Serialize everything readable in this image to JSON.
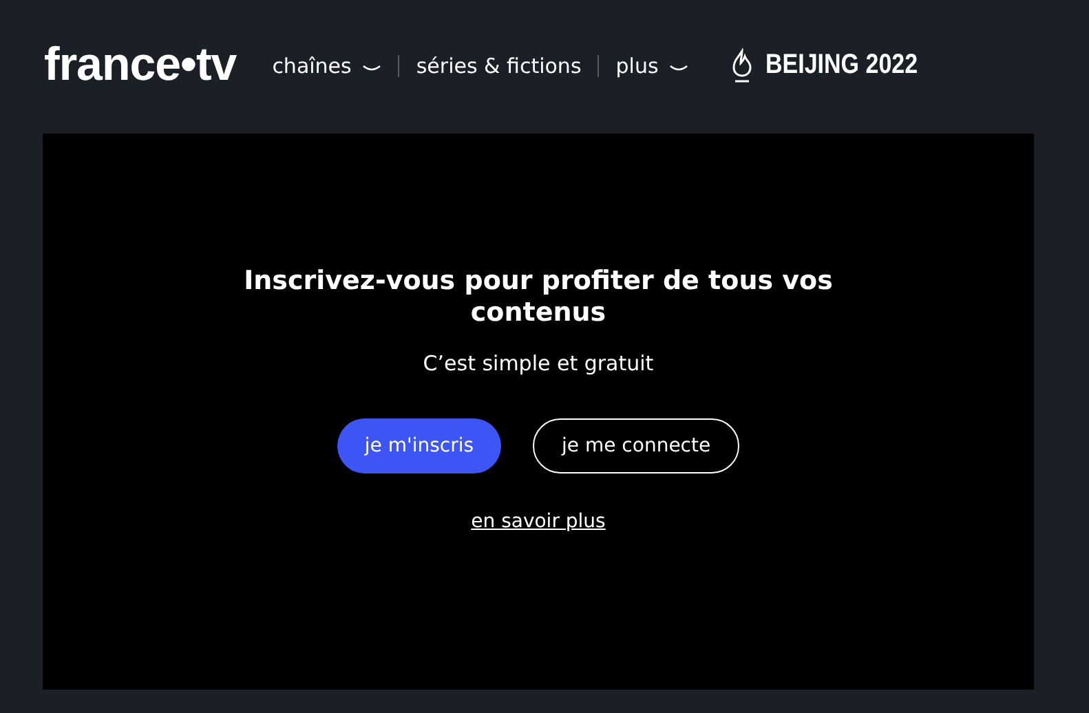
{
  "header": {
    "logo": "france•tv",
    "nav": [
      {
        "label": "chaînes",
        "dropdown": true
      },
      {
        "label": "séries & fictions",
        "dropdown": false
      },
      {
        "label": "plus",
        "dropdown": true
      }
    ],
    "event": "BEIJING 2022"
  },
  "panel": {
    "title": "Inscrivez-vous pour profiter de tous vos contenus",
    "subtitle": "C’est simple et gratuit",
    "buttons": [
      {
        "label": "je m'inscris",
        "kind": "primary"
      },
      {
        "label": "je me connecte",
        "kind": "outline"
      }
    ],
    "link": "en savoir plus"
  }
}
